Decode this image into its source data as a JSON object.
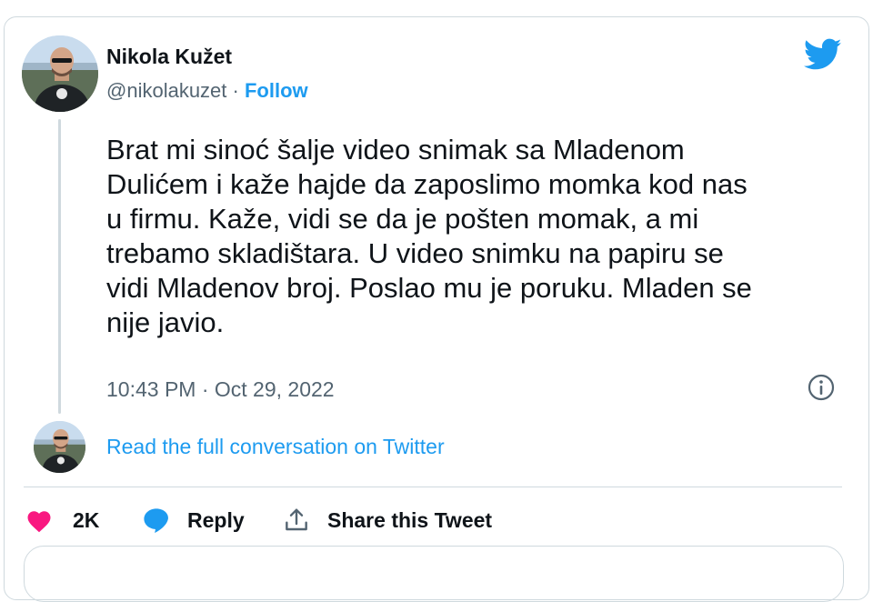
{
  "author": {
    "name": "Nikola Kužet",
    "handle": "@nikolakuzet",
    "separator": " · ",
    "follow_label": "Follow"
  },
  "tweet": {
    "text": "Brat mi sinoć šalje video snimak sa Mladenom\nDulićem i kaže hajde da zaposlimo momka kod nas\nu firmu. Kaže, vidi se da je pošten momak, a mi\ntrebamo skladištara. U video snimku na papiru se\nvidi Mladenov broj. Poslao mu je poruku. Mladen se\nnije javio.",
    "timestamp": "10:43 PM · Oct 29, 2022"
  },
  "conversation": {
    "link_label": "Read the full conversation on Twitter"
  },
  "actions": {
    "like_count": "2K",
    "reply_label": "Reply",
    "share_label": "Share this Tweet"
  },
  "icons": {
    "brand": "twitter-bird-icon",
    "info": "info-icon",
    "like": "heart-icon",
    "reply": "speech-bubble-icon",
    "share": "share-upload-icon"
  },
  "colors": {
    "accent": "#1d9bf0",
    "heart": "#f91880",
    "text": "#0f1419",
    "muted": "#536471",
    "border": "#cfd9de"
  }
}
